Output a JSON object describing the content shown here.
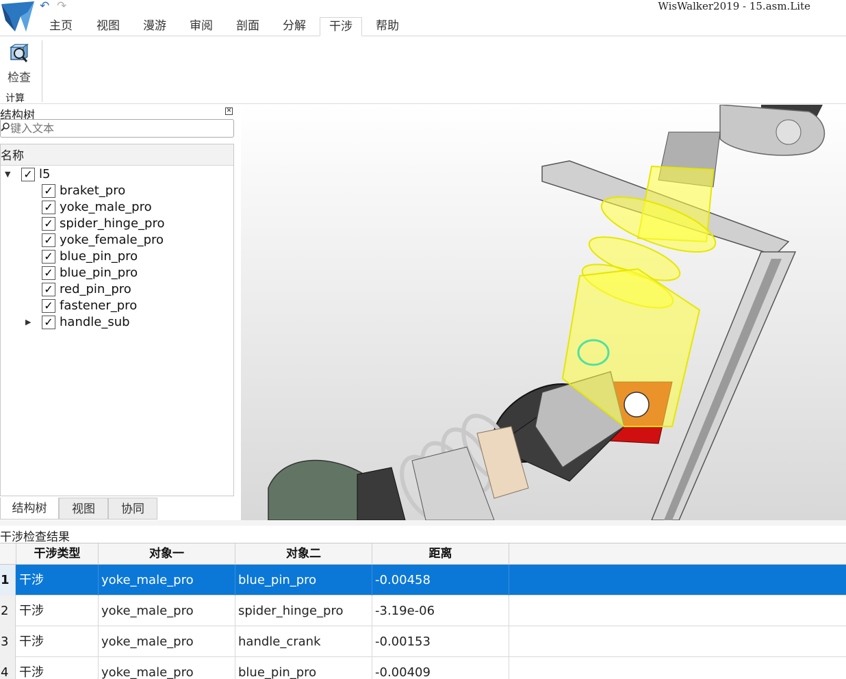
{
  "app": {
    "title": "WisWalker2019 - 15.asm.Lite",
    "logo_icon": "wiswalker-logo-icon",
    "undo_icon": "undo-icon",
    "redo_icon": "redo-icon"
  },
  "menu_tabs": [
    {
      "label": "主页",
      "active": false
    },
    {
      "label": "视图",
      "active": false
    },
    {
      "label": "漫游",
      "active": false
    },
    {
      "label": "审阅",
      "active": false
    },
    {
      "label": "剖面",
      "active": false
    },
    {
      "label": "分解",
      "active": false
    },
    {
      "label": "干涉",
      "active": true
    },
    {
      "label": "帮助",
      "active": false
    }
  ],
  "ribbon": {
    "inspect_label": "检查",
    "inspect_icon": "inspect-icon",
    "group_label": "计算"
  },
  "structure_panel": {
    "title": "结构树",
    "close_icon": "close-icon",
    "search_placeholder": "键入文本",
    "column_header": "名称",
    "root": {
      "label": "l5",
      "checked": true,
      "expanded": true
    },
    "items": [
      {
        "label": "braket_pro",
        "checked": true
      },
      {
        "label": "yoke_male_pro",
        "checked": true
      },
      {
        "label": "spider_hinge_pro",
        "checked": true
      },
      {
        "label": "yoke_female_pro",
        "checked": true
      },
      {
        "label": "blue_pin_pro",
        "checked": true
      },
      {
        "label": "blue_pin_pro",
        "checked": true
      },
      {
        "label": "red_pin_pro",
        "checked": true
      },
      {
        "label": "fastener_pro",
        "checked": true
      },
      {
        "label": "handle_sub",
        "checked": true,
        "collapsed": true
      }
    ],
    "bottom_tabs": [
      "结构树",
      "视图",
      "协同"
    ]
  },
  "results": {
    "title": "干涉检查结果",
    "columns": [
      "干涉类型",
      "对象一",
      "对象二",
      "距离"
    ],
    "rows": [
      {
        "num": "1",
        "type": "干涉",
        "obj1": "yoke_male_pro",
        "obj2": "blue_pin_pro",
        "distance": "-0.00458",
        "selected": true
      },
      {
        "num": "2",
        "type": "干涉",
        "obj1": "yoke_male_pro",
        "obj2": "spider_hinge_pro",
        "distance": "-3.19e-06",
        "selected": false
      },
      {
        "num": "3",
        "type": "干涉",
        "obj1": "yoke_male_pro",
        "obj2": "handle_crank",
        "distance": "-0.00153",
        "selected": false
      },
      {
        "num": "4",
        "type": "干涉",
        "obj1": "yoke_male_pro",
        "obj2": "blue_pin_pro",
        "distance": "-0.00409",
        "selected": false
      }
    ]
  },
  "colors": {
    "selection": "#0b78d7",
    "highlight_wireframe": "#ffff20",
    "pin_red": "#d01010"
  }
}
